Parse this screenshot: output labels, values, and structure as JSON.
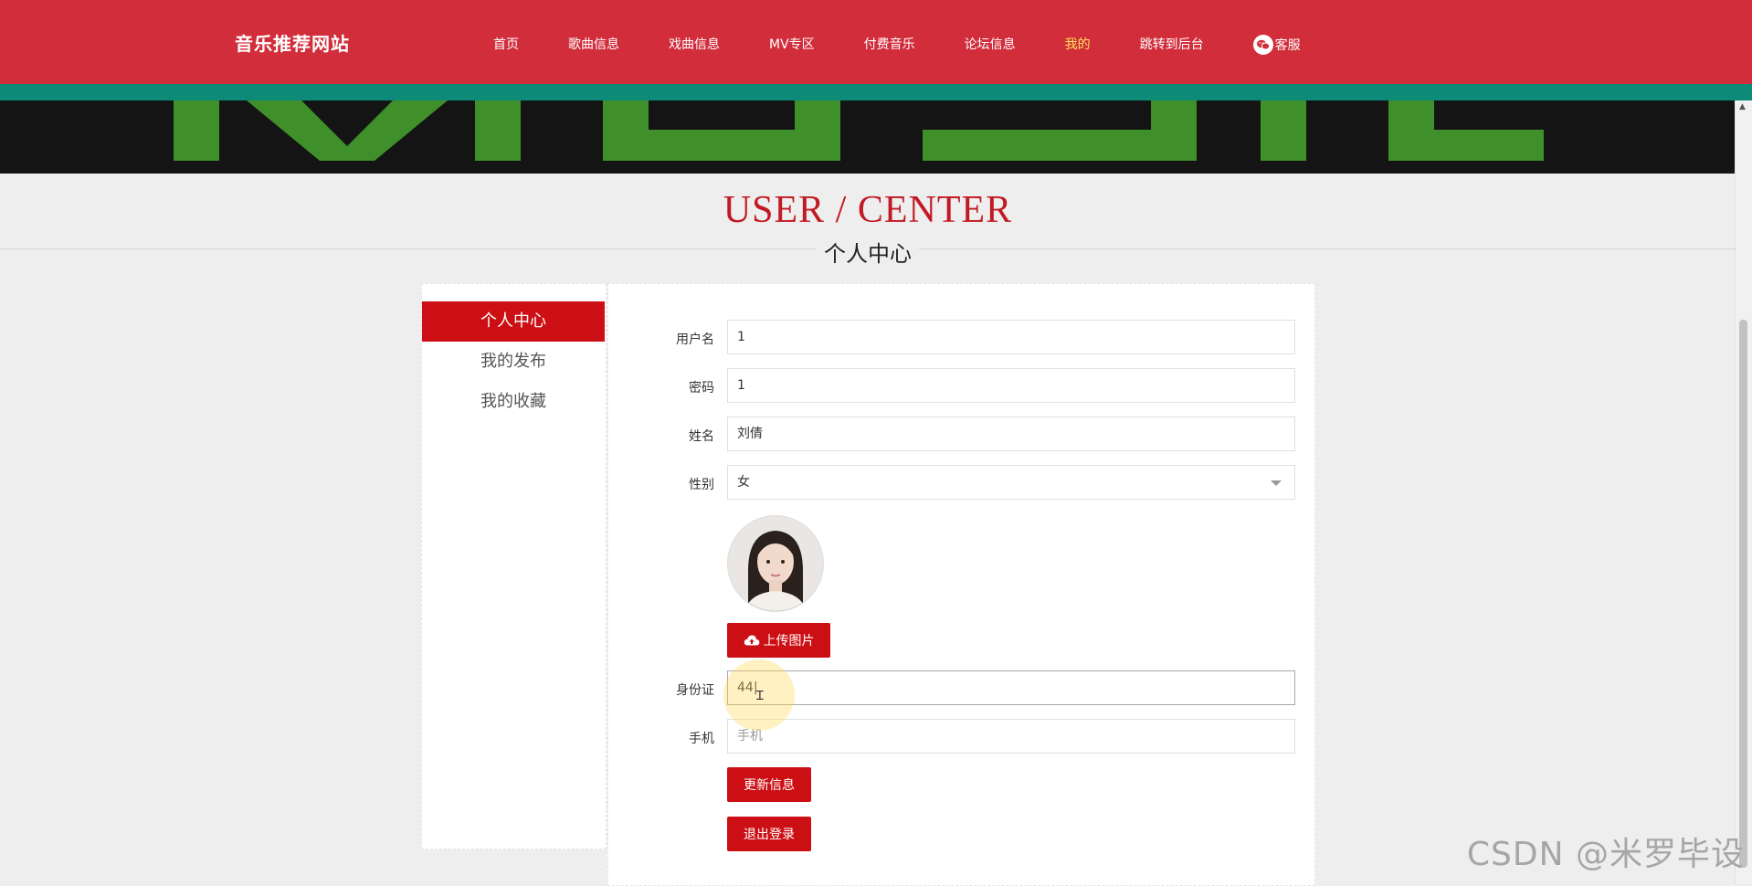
{
  "header": {
    "brand": "音乐推荐网站",
    "nav": [
      "首页",
      "歌曲信息",
      "戏曲信息",
      "MV专区",
      "付费音乐",
      "论坛信息",
      "我的",
      "跳转到后台"
    ],
    "active_nav": "我的",
    "service": "客服"
  },
  "page_title": {
    "en": "USER / CENTER",
    "cn": "个人中心"
  },
  "sidebar": {
    "items": [
      "个人中心",
      "我的发布",
      "我的收藏"
    ],
    "active": "个人中心"
  },
  "form": {
    "username": {
      "label": "用户名",
      "value": "1"
    },
    "password": {
      "label": "密码",
      "value": "1"
    },
    "name": {
      "label": "姓名",
      "value": "刘倩"
    },
    "gender": {
      "label": "性别",
      "value": "女"
    },
    "upload_button": "上传图片",
    "id_card": {
      "label": "身份证",
      "value": "44"
    },
    "phone": {
      "label": "手机",
      "placeholder": "手机"
    },
    "update_button": "更新信息",
    "logout_button": "退出登录"
  },
  "watermark": "CSDN @米罗毕设",
  "colors": {
    "header": "#d12d3b",
    "teal": "#0d8a78",
    "accent": "#cc0f14",
    "nav_active": "#ffe45c"
  }
}
